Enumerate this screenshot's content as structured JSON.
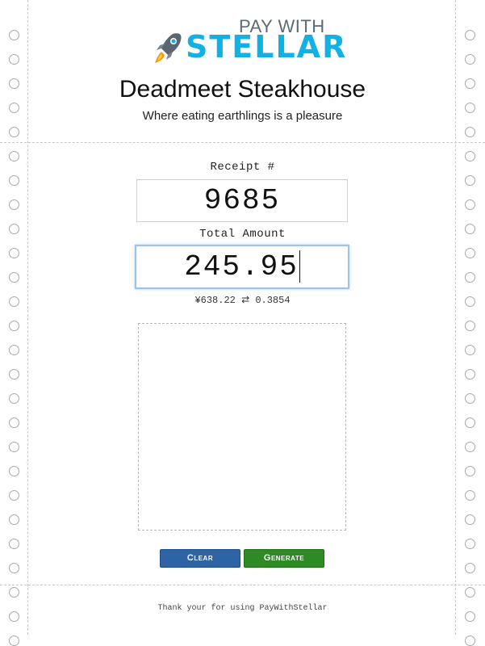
{
  "brand": {
    "pay_with": "PAY WITH",
    "stellar": "STELLAR",
    "logo_icon": "rocket-icon",
    "accent_color": "#10b1e5"
  },
  "store": {
    "name": "Deadmeet Steakhouse",
    "tagline": "Where eating earthlings is a pleasure"
  },
  "receipt": {
    "label": "Receipt #",
    "value": "9685"
  },
  "total": {
    "label": "Total Amount",
    "value": "245.95"
  },
  "conversion": {
    "text": "¥638.22 ⇄ 0.3854"
  },
  "buttons": {
    "clear_label": "Clear",
    "generate_label": "Generate",
    "clear_color": "#2e64a3",
    "generate_color": "#2e8a25"
  },
  "footer": {
    "text": "Thank your for using PayWithStellar"
  }
}
